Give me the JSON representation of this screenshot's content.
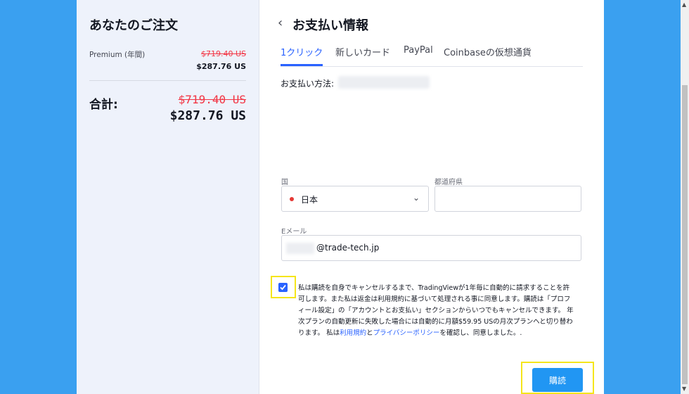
{
  "order": {
    "title": "あなたのご注文",
    "plan_name": "Premium (年間)",
    "plan_price_old": "$719.40 US",
    "plan_price_new": "$287.76 US",
    "total_label": "合計:",
    "total_old": "$719.40 US",
    "total_new": "$287.76 US"
  },
  "payment": {
    "back_icon": "chevron-left-icon",
    "title": "お支払い情報",
    "tabs": [
      {
        "label": "1クリック",
        "active": true
      },
      {
        "label": "新しいカード",
        "active": false
      },
      {
        "label": "PayPal",
        "active": false
      },
      {
        "label": "Coinbaseの仮想通貨",
        "active": false
      }
    ],
    "method_label": "お支払い方法:",
    "country_label": "国",
    "country_value": "日本",
    "prefecture_label": "都道府県",
    "prefecture_value": "",
    "email_label": "Eメール",
    "email_value": "@trade-tech.jp",
    "consent_checked": true,
    "terms_text_1": "私は購読を自身でキャンセルするまで、TradingViewが1年毎に自動的に請求することを許可します。また私は返金は利用規約に基づいて処理される事に同意します。購読は「プロフィール設定」の「アカウントとお支払い」セクションからいつでもキャンセルできます。 年次プランの自動更新に失敗した場合には自動的に月額$59.95 USの月次プランへと切り替わります。 私は",
    "terms_link_1": "利用規約",
    "terms_and": "と",
    "terms_link_2": "プライバシーポリシー",
    "terms_text_2": "を確認し、同意しました。.",
    "buy_label": "購読"
  },
  "colors": {
    "background": "#3aa0f0",
    "accent": "#2962ff",
    "strike": "#f23645",
    "buy_button": "#2196f3",
    "highlight": "#f5e51b"
  }
}
